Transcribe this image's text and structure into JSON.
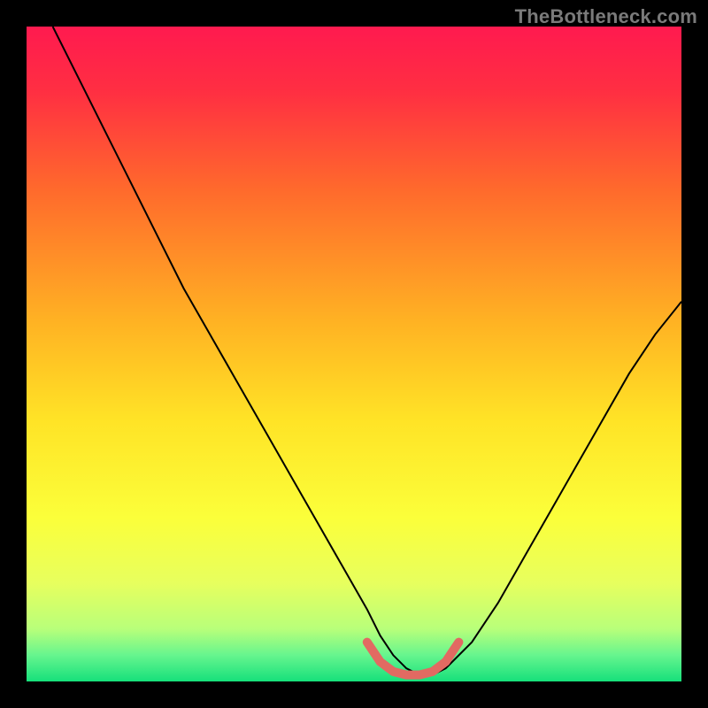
{
  "watermark": "TheBottleneck.com",
  "chart_data": {
    "type": "line",
    "title": "",
    "xlabel": "",
    "ylabel": "",
    "xlim": [
      0,
      100
    ],
    "ylim": [
      0,
      100
    ],
    "gradient_stops": [
      {
        "offset": 0,
        "color": "#ff1a4f"
      },
      {
        "offset": 10,
        "color": "#ff2f42"
      },
      {
        "offset": 25,
        "color": "#ff6a2c"
      },
      {
        "offset": 45,
        "color": "#ffb223"
      },
      {
        "offset": 60,
        "color": "#ffe326"
      },
      {
        "offset": 75,
        "color": "#fbff3a"
      },
      {
        "offset": 85,
        "color": "#e7ff5e"
      },
      {
        "offset": 92,
        "color": "#b8ff7a"
      },
      {
        "offset": 96,
        "color": "#66f58e"
      },
      {
        "offset": 100,
        "color": "#16e07b"
      }
    ],
    "series": [
      {
        "name": "curve",
        "color": "#000000",
        "width": 2,
        "x": [
          4,
          8,
          12,
          16,
          20,
          24,
          28,
          32,
          36,
          40,
          44,
          48,
          52,
          54,
          56,
          58,
          60,
          62,
          64,
          68,
          72,
          76,
          80,
          84,
          88,
          92,
          96,
          100
        ],
        "y": [
          100,
          92,
          84,
          76,
          68,
          60,
          53,
          46,
          39,
          32,
          25,
          18,
          11,
          7,
          4,
          2,
          1,
          1,
          2,
          6,
          12,
          19,
          26,
          33,
          40,
          47,
          53,
          58
        ]
      },
      {
        "name": "bottom-marker",
        "color": "#e26a62",
        "width": 10,
        "linecap": "round",
        "x": [
          52,
          54,
          56,
          58,
          60,
          62,
          64,
          66
        ],
        "y": [
          6,
          3,
          1.5,
          1,
          1,
          1.5,
          3,
          6
        ]
      }
    ]
  }
}
